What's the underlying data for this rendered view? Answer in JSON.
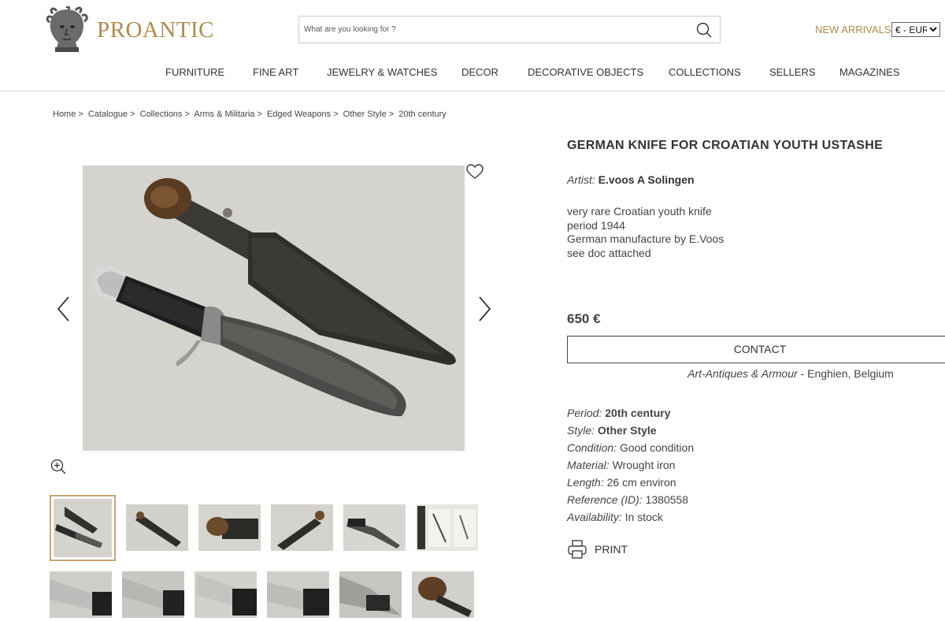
{
  "header": {
    "brand": "PROANTIC",
    "search_placeholder": "What are you looking for ?",
    "new_arrivals": "NEW ARRIVALS",
    "currency": "€ - EUR",
    "accent_color": "#b08a50"
  },
  "nav": {
    "items": [
      "FURNITURE",
      "FINE ART",
      "JEWELRY & WATCHES",
      "DECOR",
      "DECORATIVE OBJECTS",
      "COLLECTIONS",
      "SELLERS",
      "MAGAZINES"
    ]
  },
  "breadcrumb": {
    "items": [
      "Home",
      "Catalogue",
      "Collections",
      "Arms & Militaria",
      "Edged Weapons",
      "Other Style",
      "20th century"
    ],
    "separator": ">"
  },
  "product": {
    "title": "GERMAN KNIFE FOR CROATIAN YOUTH USTASHE",
    "artist_label": "Artist:",
    "artist": "E.voos A Solingen",
    "description": [
      "very rare Croatian youth knife",
      "period 1944",
      "German manufacture by E.Voos",
      "see doc attached"
    ],
    "price": "650 €",
    "contact_label": "CONTACT",
    "seller_name": "Art-Antiques & Armour",
    "seller_sep": " - ",
    "seller_location": "Enghien, Belgium",
    "specs": {
      "period_label": "Period:",
      "period": "20th century",
      "style_label": "Style:",
      "style": "Other Style",
      "condition_label": "Condition:",
      "condition": "Good condition",
      "material_label": "Material:",
      "material": "Wrought iron",
      "length_label": "Length:",
      "length": "26 cm environ",
      "reference_label": "Reference (ID):",
      "reference": "1380558",
      "availability_label": "Availability:",
      "availability": "In stock"
    },
    "print_label": "PRINT"
  },
  "gallery": {
    "thumbnail_count": 12,
    "selected_index": 0
  }
}
